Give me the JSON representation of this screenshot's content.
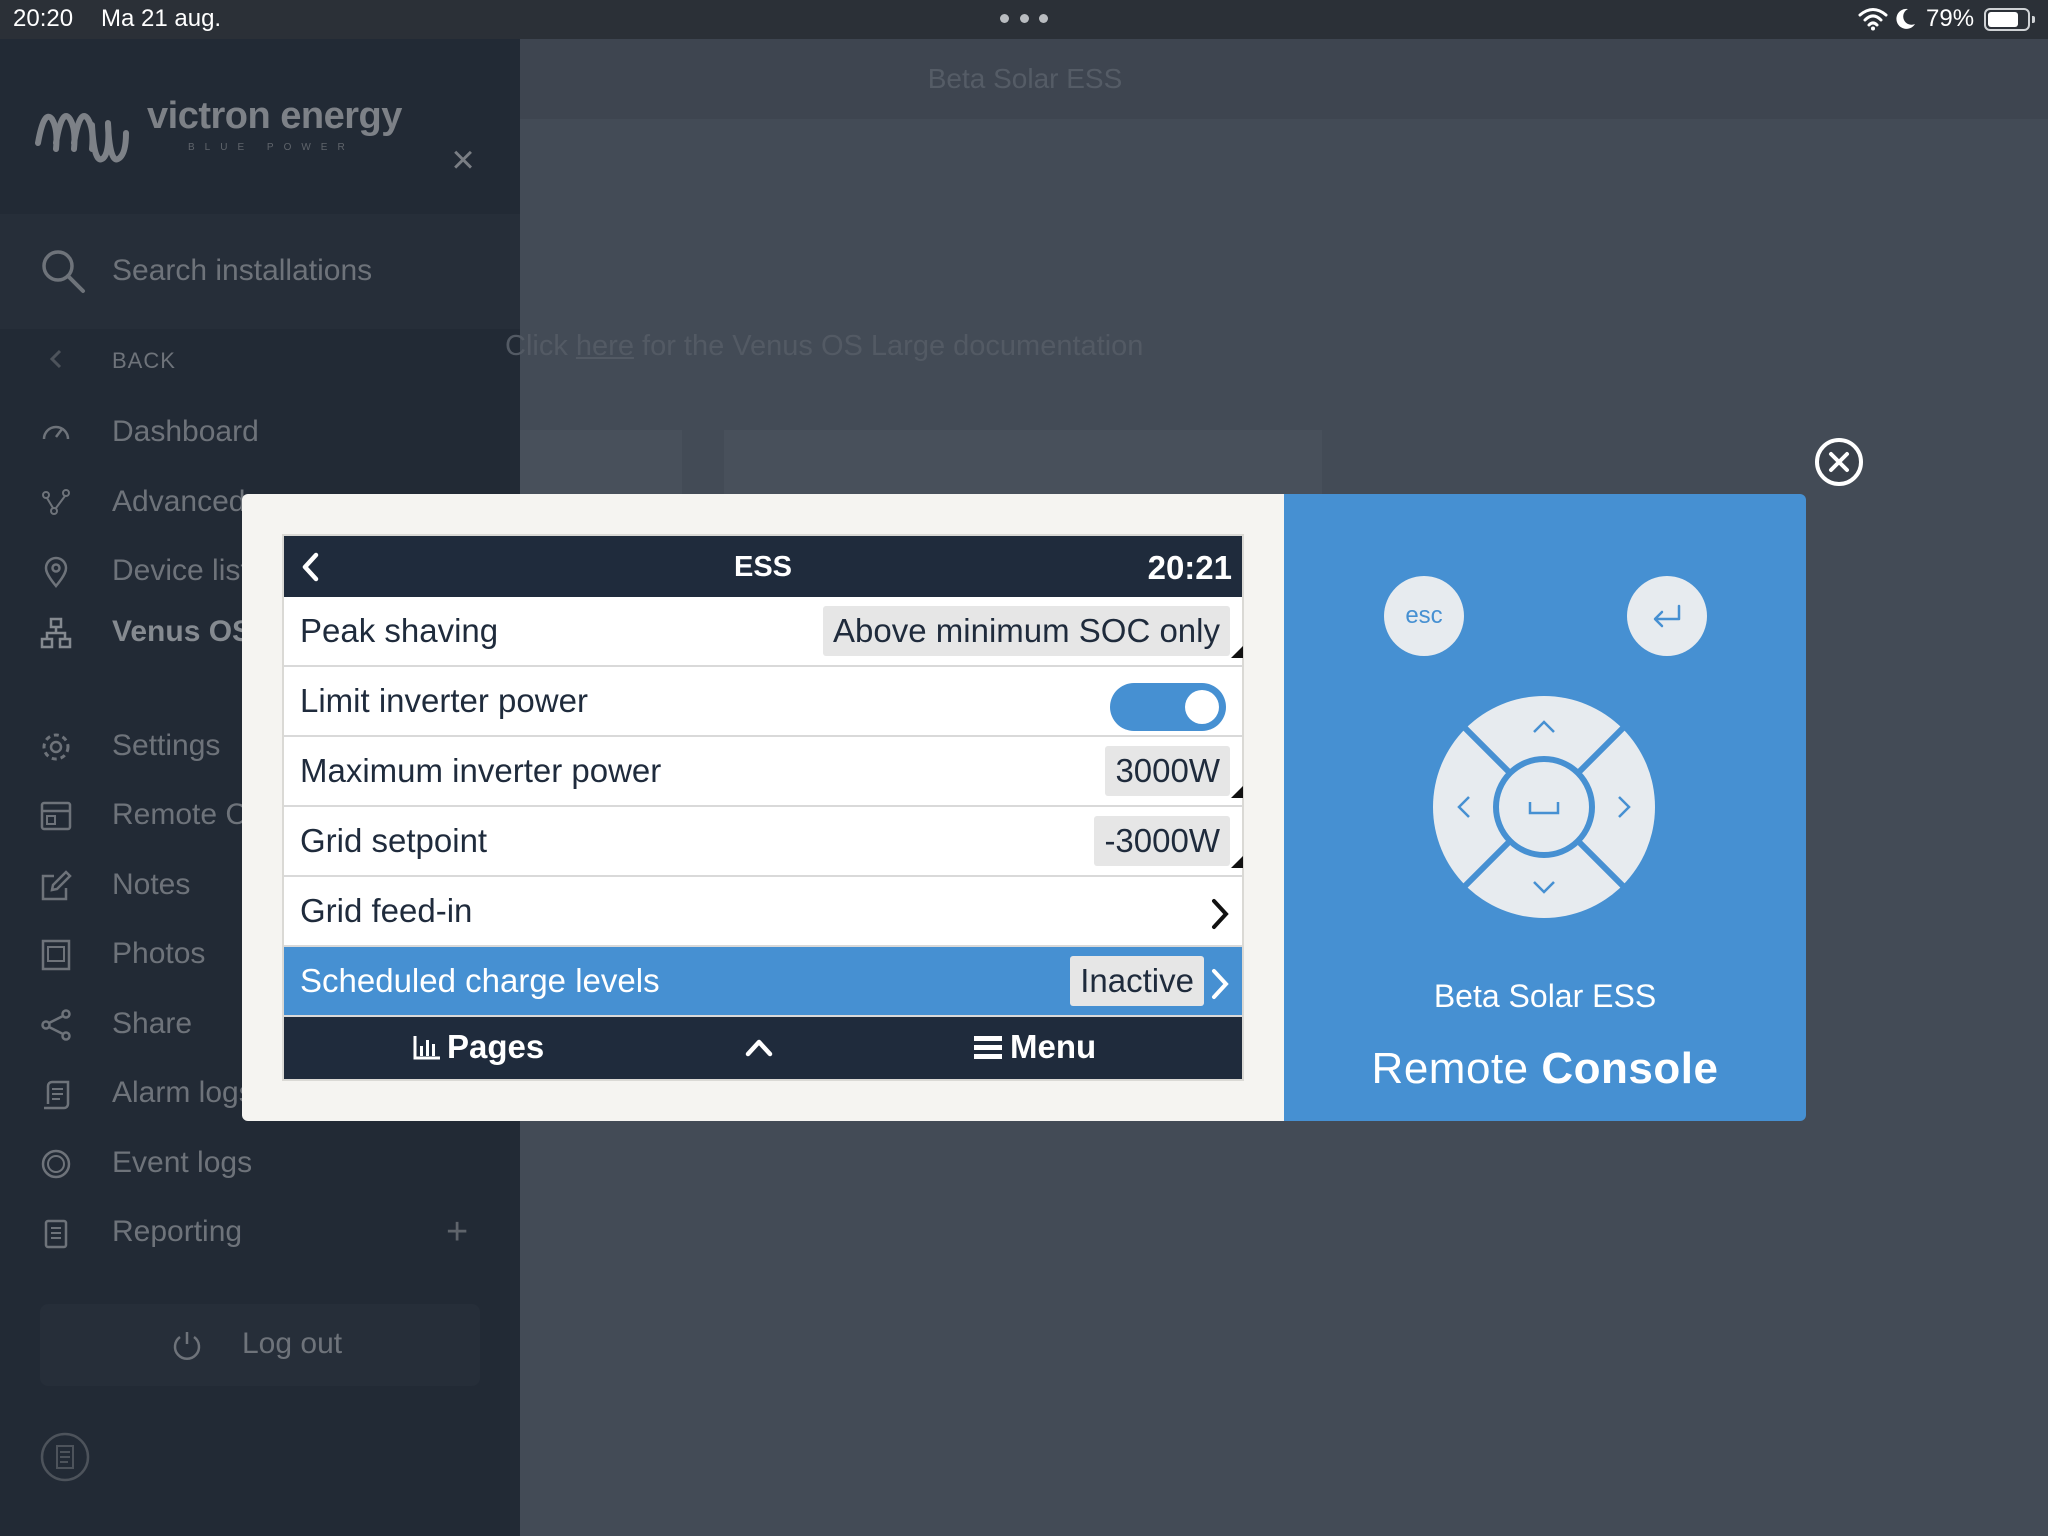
{
  "status_bar": {
    "time": "20:20",
    "date": "Ma 21 aug.",
    "battery_percent": "79%",
    "battery_level": 0.79
  },
  "sidebar": {
    "logo_text": "victron energy",
    "logo_sub": "BLUE POWER",
    "search_placeholder": "Search installations",
    "back_label": "BACK",
    "items": [
      {
        "label": "Dashboard",
        "icon": "dashboard-icon"
      },
      {
        "label": "Advanced",
        "icon": "chart-nodes-icon"
      },
      {
        "label": "Device list",
        "icon": "location-pin-icon"
      },
      {
        "label": "Venus OS",
        "icon": "network-icon"
      },
      {
        "label": "Settings",
        "icon": "gear-icon"
      },
      {
        "label": "Remote Console",
        "icon": "monitor-icon"
      },
      {
        "label": "Notes",
        "icon": "edit-icon"
      },
      {
        "label": "Photos",
        "icon": "photo-icon"
      },
      {
        "label": "Share",
        "icon": "share-icon"
      },
      {
        "label": "Alarm logs",
        "icon": "alarm-log-icon"
      },
      {
        "label": "Event logs",
        "icon": "event-log-icon"
      },
      {
        "label": "Reporting",
        "icon": "report-icon"
      }
    ],
    "logout_label": "Log out"
  },
  "main": {
    "title": "Beta Solar ESS",
    "doc_prefix": "Click",
    "doc_link": "here",
    "doc_suffix": "for the Venus OS Large documentation"
  },
  "modal": {
    "screen": {
      "title": "ESS",
      "time": "20:21",
      "rows": [
        {
          "label": "Peak shaving",
          "value": "Above minimum SOC only"
        },
        {
          "label": "Limit inverter power",
          "toggle": true
        },
        {
          "label": "Maximum inverter power",
          "value": "3000W"
        },
        {
          "label": "Grid setpoint",
          "value": "-3000W"
        },
        {
          "label": "Grid feed-in"
        },
        {
          "label": "Scheduled charge levels",
          "value": "Inactive",
          "selected": true
        }
      ],
      "footer": {
        "pages_label": "Pages",
        "menu_label": "Menu"
      }
    },
    "console": {
      "esc_label": "esc",
      "site_name": "Beta Solar ESS",
      "title_light": "Remote",
      "title_bold": "Console"
    }
  },
  "colors": {
    "console_blue": "#4690d2",
    "screen_header": "#1f2b3c",
    "sidebar_bg": "#222a35"
  }
}
